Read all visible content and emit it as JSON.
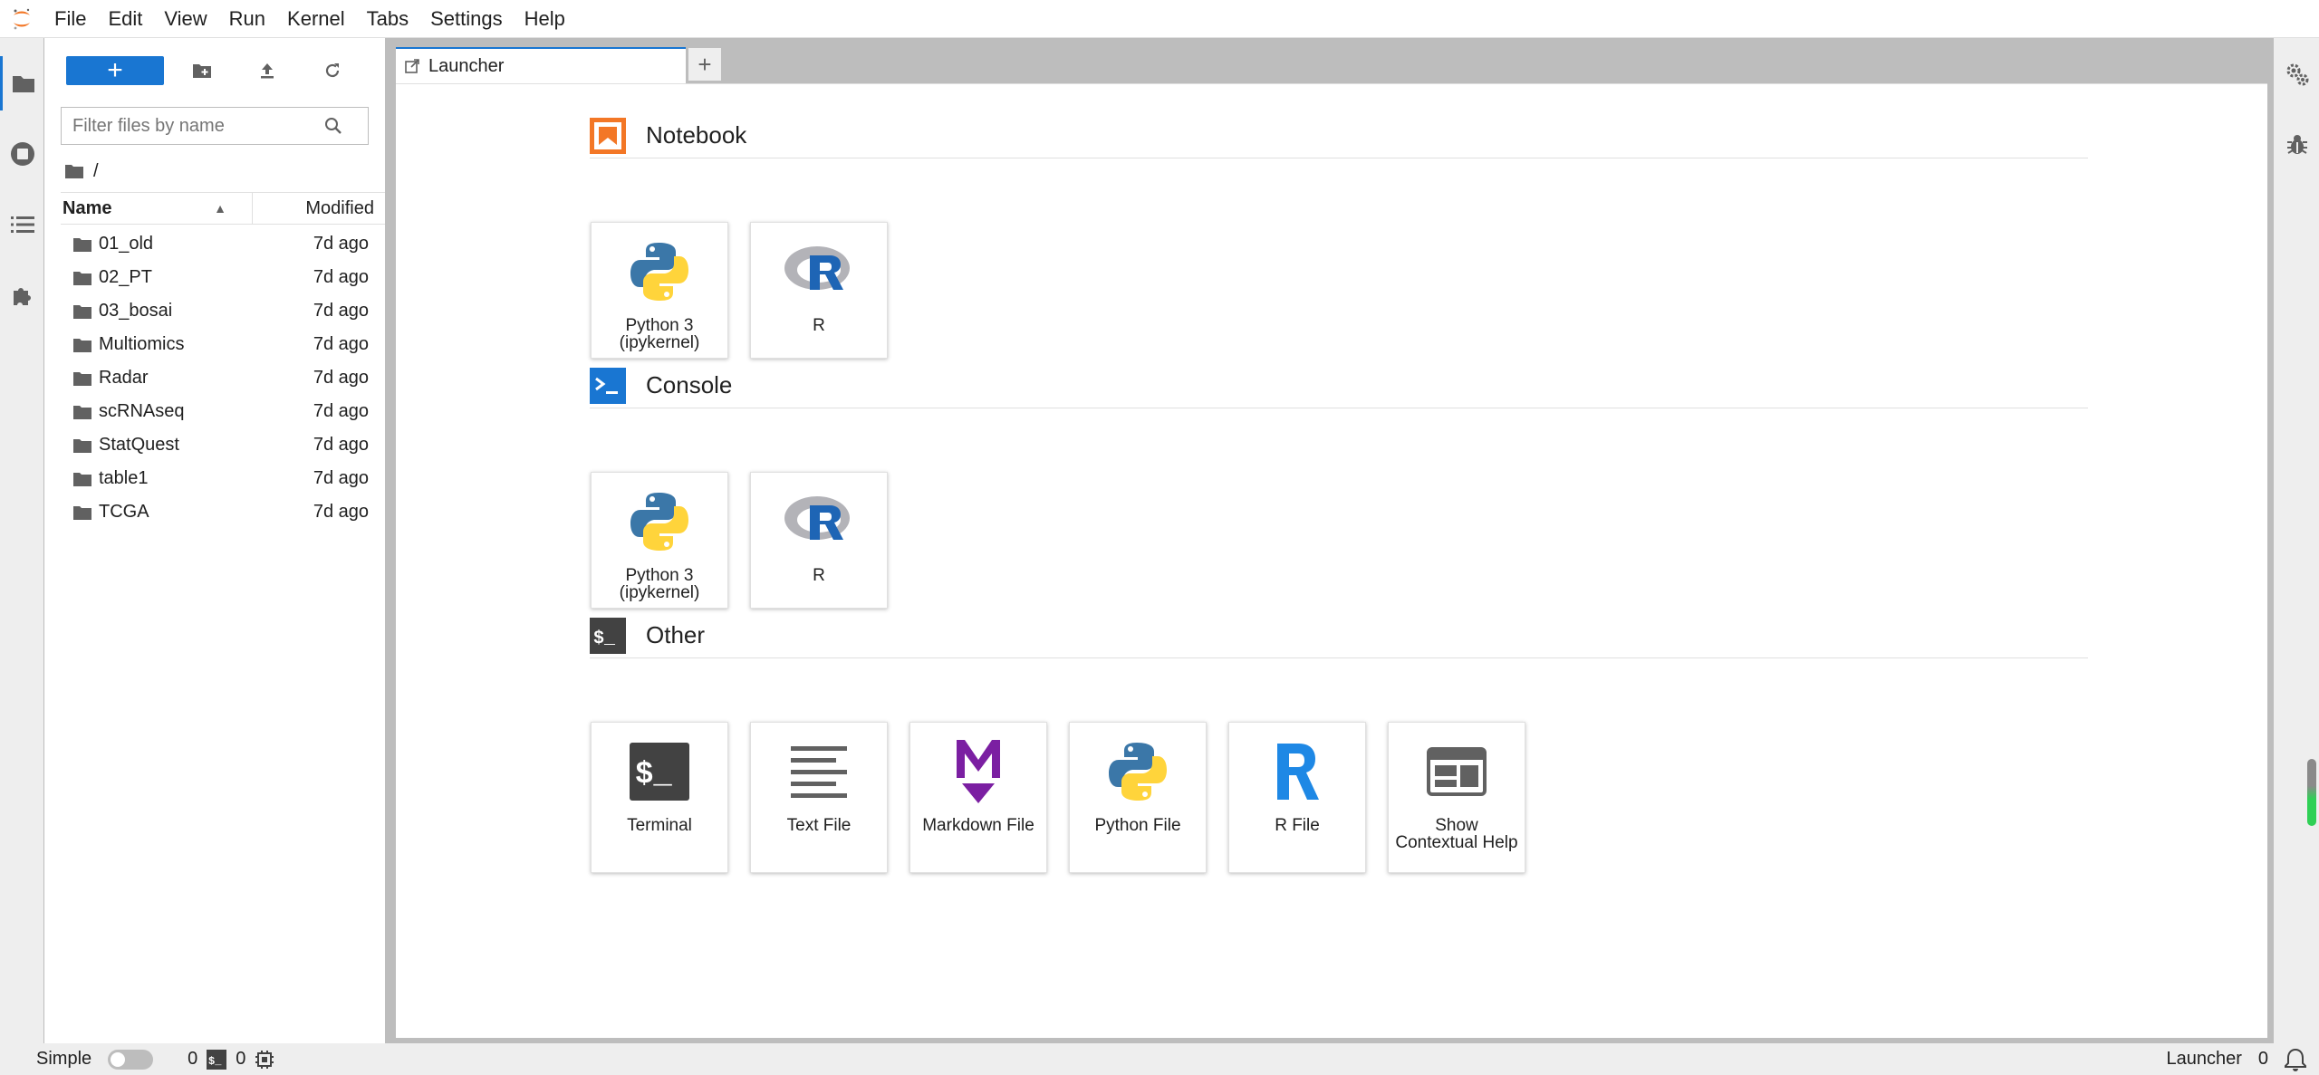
{
  "menu": [
    "File",
    "Edit",
    "View",
    "Run",
    "Kernel",
    "Tabs",
    "Settings",
    "Help"
  ],
  "file_browser": {
    "new_button_label": "+",
    "filter_placeholder": "Filter files by name",
    "breadcrumb": "/",
    "columns": {
      "name": "Name",
      "modified": "Modified"
    },
    "items": [
      {
        "name": "01_old",
        "modified": "7d ago"
      },
      {
        "name": "02_PT",
        "modified": "7d ago"
      },
      {
        "name": "03_bosai",
        "modified": "7d ago"
      },
      {
        "name": "Multiomics",
        "modified": "7d ago"
      },
      {
        "name": "Radar",
        "modified": "7d ago"
      },
      {
        "name": "scRNAseq",
        "modified": "7d ago"
      },
      {
        "name": "StatQuest",
        "modified": "7d ago"
      },
      {
        "name": "table1",
        "modified": "7d ago"
      },
      {
        "name": "TCGA",
        "modified": "7d ago"
      }
    ]
  },
  "tabs": {
    "launcher_label": "Launcher",
    "add_label": "+"
  },
  "launcher": {
    "notebook": {
      "title": "Notebook",
      "cards": [
        {
          "label": "Python 3 (ipykernel)",
          "icon": "python-icon"
        },
        {
          "label": "R",
          "icon": "r-logo-icon"
        }
      ]
    },
    "console": {
      "title": "Console",
      "cards": [
        {
          "label": "Python 3 (ipykernel)",
          "icon": "python-icon"
        },
        {
          "label": "R",
          "icon": "r-logo-icon"
        }
      ]
    },
    "other": {
      "title": "Other",
      "cards": [
        {
          "label": "Terminal",
          "icon": "terminal-icon"
        },
        {
          "label": "Text File",
          "icon": "text-file-icon"
        },
        {
          "label": "Markdown File",
          "icon": "markdown-icon"
        },
        {
          "label": "Python File",
          "icon": "python-icon"
        },
        {
          "label": "R File",
          "icon": "r-file-icon"
        },
        {
          "label": "Show Contextual Help",
          "icon": "contextual-help-icon"
        }
      ]
    }
  },
  "status": {
    "mode_label": "Simple",
    "kernels_count": "0",
    "terminals_count": "0",
    "launcher_label": "Launcher",
    "notifications_count": "0"
  },
  "colors": {
    "accent": "#1976d2",
    "brand_orange": "#f37726"
  }
}
